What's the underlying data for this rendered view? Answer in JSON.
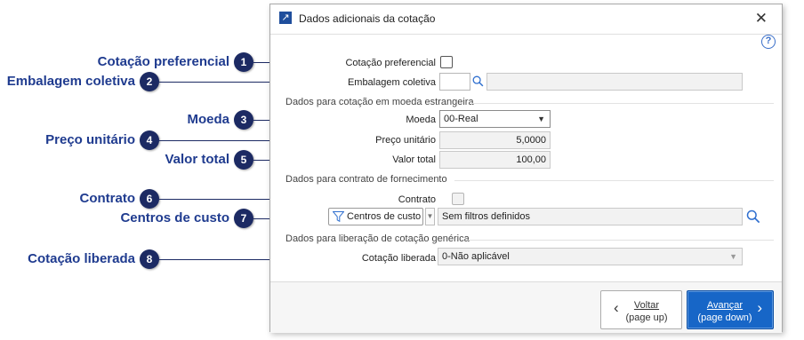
{
  "callouts": [
    {
      "num": "1",
      "label": "Cotação preferencial"
    },
    {
      "num": "2",
      "label": "Embalagem coletiva"
    },
    {
      "num": "3",
      "label": "Moeda"
    },
    {
      "num": "4",
      "label": "Preço unitário"
    },
    {
      "num": "5",
      "label": "Valor total"
    },
    {
      "num": "6",
      "label": "Contrato"
    },
    {
      "num": "7",
      "label": "Centros de custo"
    },
    {
      "num": "8",
      "label": "Cotação liberada"
    }
  ],
  "dialog": {
    "title": "Dados adicionais da cotação",
    "icons": {
      "app": "open-external-icon",
      "close": "close-icon",
      "help": "help-icon"
    }
  },
  "form": {
    "cotacao_preferencial": {
      "label": "Cotação preferencial",
      "checked": false
    },
    "embalagem_coletiva": {
      "label": "Embalagem coletiva",
      "value": "",
      "description": ""
    },
    "group_moeda": "Dados para cotação em moeda estrangeira",
    "moeda": {
      "label": "Moeda",
      "value": "00-Real"
    },
    "preco_unitario": {
      "label": "Preço unitário",
      "value": "5,0000"
    },
    "valor_total": {
      "label": "Valor total",
      "value": "100,00"
    },
    "group_contrato": "Dados para contrato de fornecimento",
    "contrato": {
      "label": "Contrato",
      "checked": false
    },
    "centros_custo": {
      "button": "Centros de custo",
      "filter_text": "Sem filtros definidos"
    },
    "group_liberacao": "Dados para liberação de cotação genérica",
    "cotacao_liberada": {
      "label": "Cotação liberada",
      "value": "0-Não aplicável"
    }
  },
  "footer": {
    "back": {
      "line1": "Voltar",
      "line2": "(page up)"
    },
    "next": {
      "line1": "Avançar",
      "line2": "(page down)"
    }
  },
  "colors": {
    "accent": "#1766c7",
    "callout": "#1c2a63",
    "callout_text": "#1f3b8f"
  }
}
